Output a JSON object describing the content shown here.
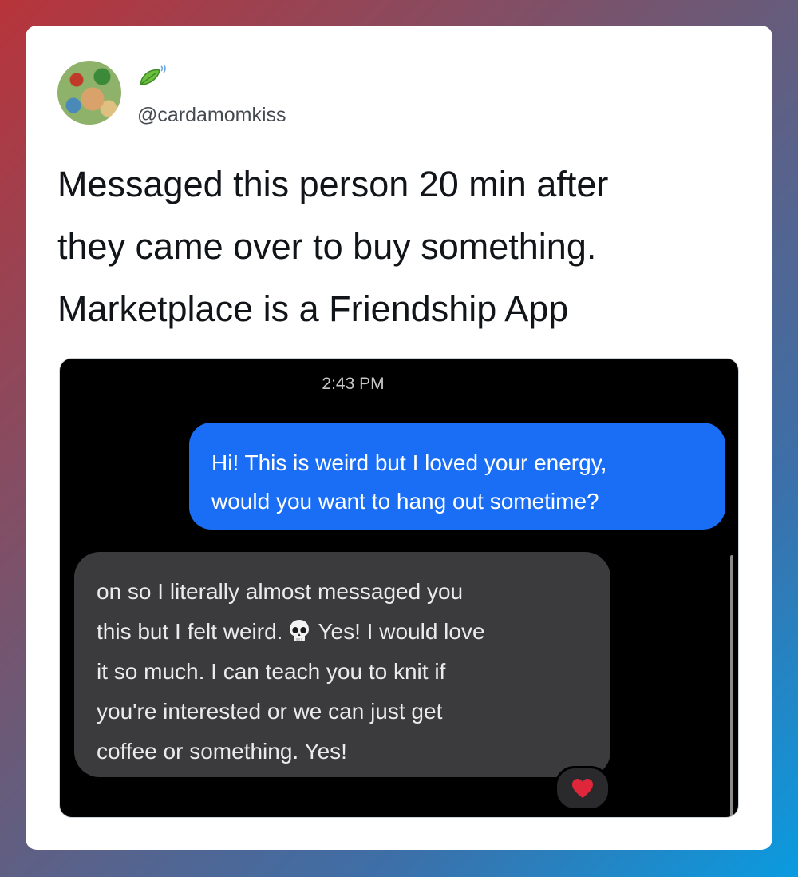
{
  "post": {
    "username": "@cardamomkiss",
    "text_lines": [
      "Messaged this person 20 min after",
      "they came over to buy something.",
      "Marketplace is a Friendship App"
    ]
  },
  "screenshot": {
    "timestamp": "2:43 PM",
    "outgoing_message_lines": [
      "Hi! This is weird but I loved your energy,",
      "would you want to hang out sometime?"
    ],
    "incoming_message_lines": [
      "on so I literally almost messaged you",
      "this but I felt weird.",
      "Yes! I would love",
      "it so much. I can teach you to knit if",
      "you're interested or we can just get",
      "coffee or something. Yes!"
    ],
    "reaction_icon": "heart-icon"
  },
  "colors": {
    "outgoing_bubble": "#1a6ef6",
    "incoming_bubble": "#3b3b3d",
    "reaction_heart": "#e0263a"
  }
}
